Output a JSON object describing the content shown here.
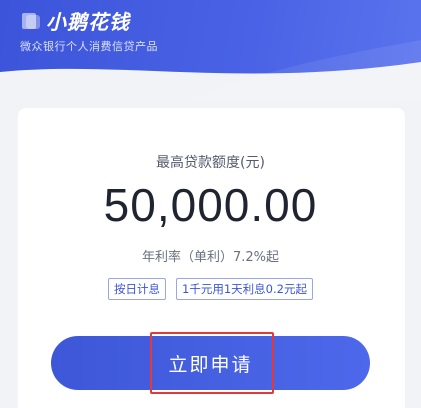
{
  "header": {
    "brand_name": "小鹅花钱",
    "subtitle": "微众银行个人消费信贷产品"
  },
  "card": {
    "amount_label": "最高贷款额度(元)",
    "amount": "50,000.00",
    "rate": "年利率（单利）7.2%起",
    "tags": [
      "按日计息",
      "1千元用1天利息0.2元起"
    ]
  },
  "apply_button": {
    "label": "立即申请"
  },
  "colors": {
    "brand_blue": "#3b54d9",
    "button_blue": "#4a63e6",
    "highlight_red": "#e23a3a",
    "background": "#f1f3f7"
  }
}
